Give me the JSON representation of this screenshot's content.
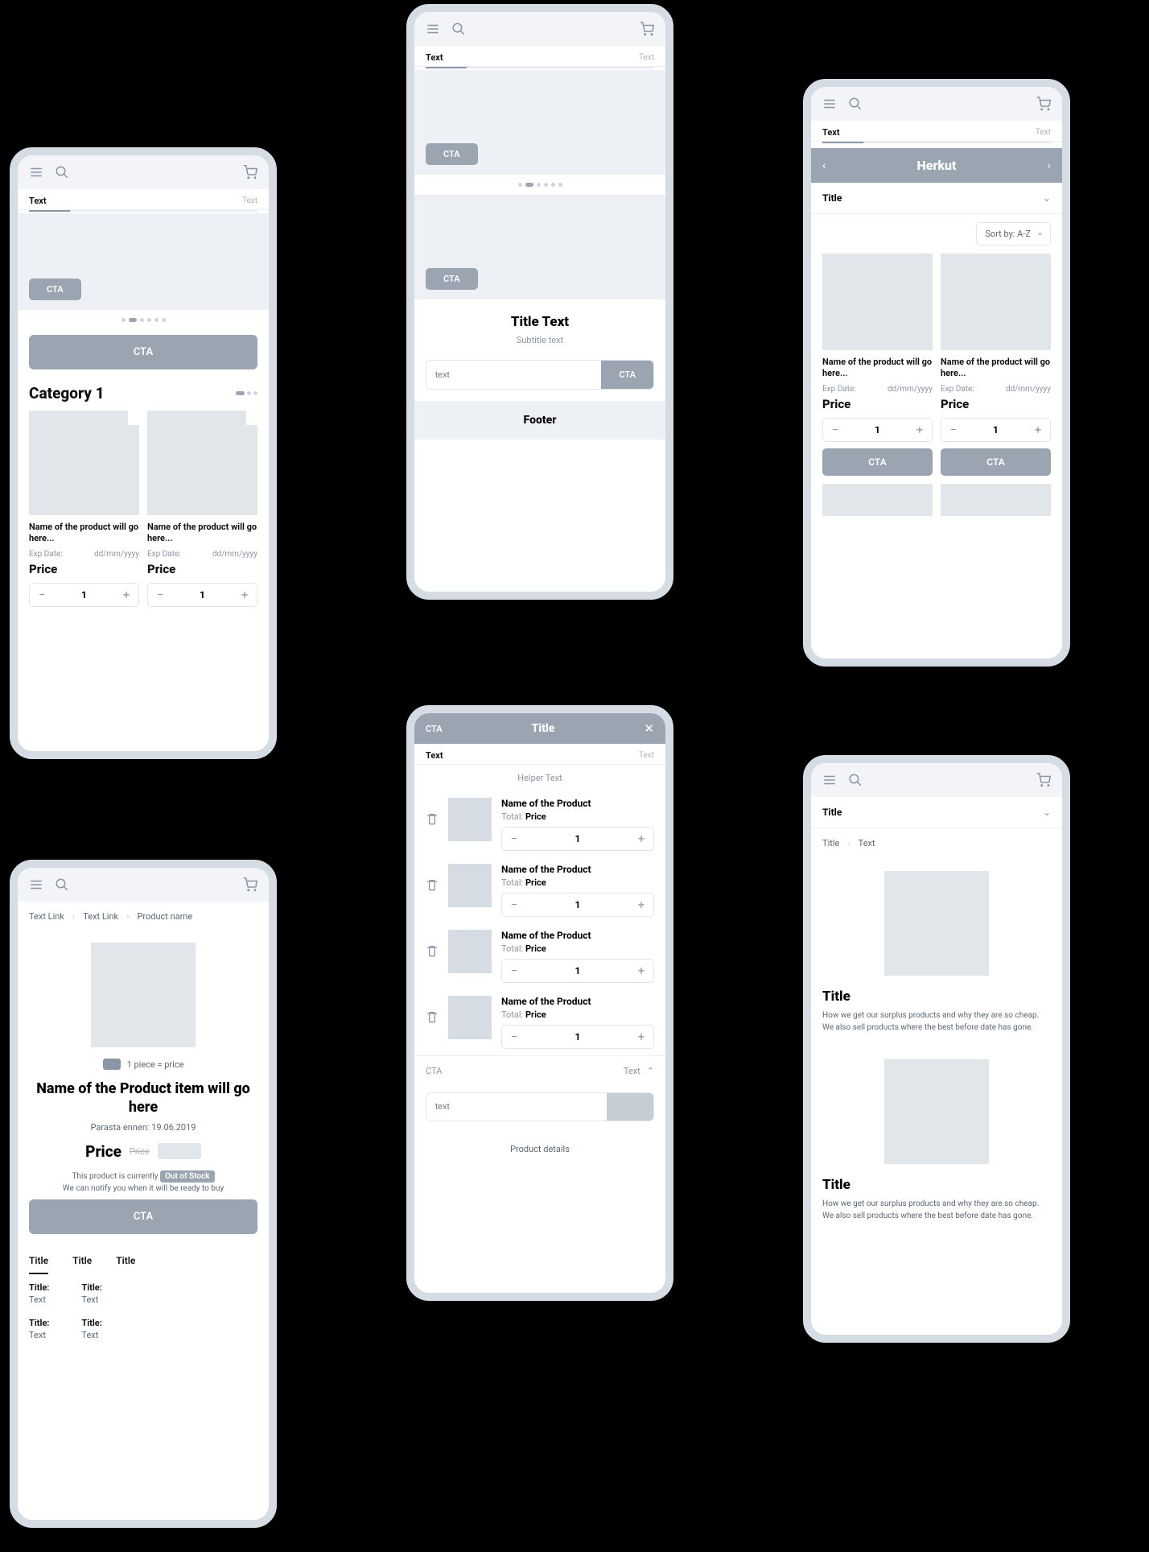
{
  "common": {
    "search_label": "Text",
    "search_hint": "Text",
    "cta_label": "CTA"
  },
  "screen1": {
    "category_title": "Category 1",
    "card1": {
      "name": "Name of the product will go here...",
      "exp_label": "Exp Date:",
      "exp_value": "dd/mm/yyyy",
      "price": "Price",
      "qty": "1"
    },
    "card2": {
      "name": "Name of the product will go here...",
      "exp_label": "Exp Date:",
      "exp_value": "dd/mm/yyyy",
      "price": "Price",
      "qty": "1"
    }
  },
  "screen2": {
    "title": "Title Text",
    "subtitle": "Subtitle text",
    "input_placeholder": "text",
    "footer": "Footer"
  },
  "screen3": {
    "category": "Herkut",
    "filter_title": "Title",
    "sort": "Sort by: A-Z",
    "card": {
      "name": "Name of the product will go here...",
      "exp_label": "Exp Date:",
      "exp_value": "dd/mm/yyyy",
      "price": "Price",
      "qty": "1"
    }
  },
  "screen4": {
    "bc1": "Text Link",
    "bc2": "Text Link",
    "bc3": "Product name",
    "piece_label": "1 piece = price",
    "title": "Name of the Product item will go here",
    "date": "Parasta ennen: 19.06.2019",
    "price": "Price",
    "price_old": "Price",
    "stock_pre": "This product is currently",
    "stock_badge": "Out of Stock",
    "stock_sub": "We can notify you when it will be ready to buy",
    "tab1": "Title",
    "tab2": "Title",
    "tab3": "Title",
    "spec_title": "Title:",
    "spec_text": "Text"
  },
  "screen5": {
    "top_l": "CTA",
    "top_c": "Title",
    "search_label": "Text",
    "search_hint": "Text",
    "helper": "Helper Text",
    "item": {
      "name": "Name of the Product",
      "total_label": "Total:",
      "total_value": "Price",
      "qty": "1"
    },
    "summary_l": "CTA",
    "summary_r": "Text",
    "input_placeholder": "text",
    "details": "Product details"
  },
  "screen6": {
    "filter_title": "Title",
    "bc1": "Title",
    "bc2": "Text",
    "block_title": "Title",
    "block_text": "How we get our surplus products and why they are so cheap. We also sell products where the best before date has gone."
  }
}
